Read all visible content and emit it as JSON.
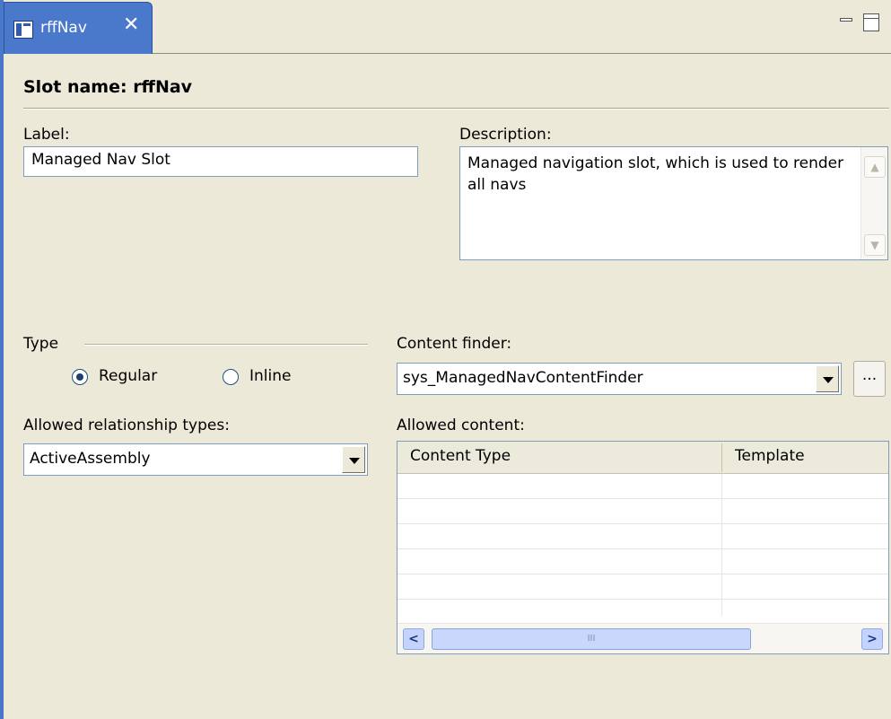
{
  "tab": {
    "label": "rffNav",
    "close_glyph": "✕"
  },
  "heading": "Slot name: rffNav",
  "label_field": {
    "label": "Label:",
    "value": "Managed Nav Slot"
  },
  "description_field": {
    "label": "Description:",
    "value": "Managed navigation slot, which is used to render all navs"
  },
  "type_group": {
    "label": "Type",
    "options": [
      {
        "label": "Regular",
        "selected": true
      },
      {
        "label": "Inline",
        "selected": false
      }
    ]
  },
  "content_finder": {
    "label": "Content finder:",
    "value": "sys_ManagedNavContentFinder",
    "browse_label": "..."
  },
  "relationship_types": {
    "label": "Allowed relationship types:",
    "value": "ActiveAssembly"
  },
  "allowed_content": {
    "label": "Allowed content:",
    "columns": [
      "Content Type",
      "Template"
    ],
    "rows": [],
    "scroll_thumb_glyph": "III"
  },
  "colors": {
    "tab_active": "#4a79cc",
    "background": "#ece9d8",
    "frame_border": "#4a78c8"
  }
}
